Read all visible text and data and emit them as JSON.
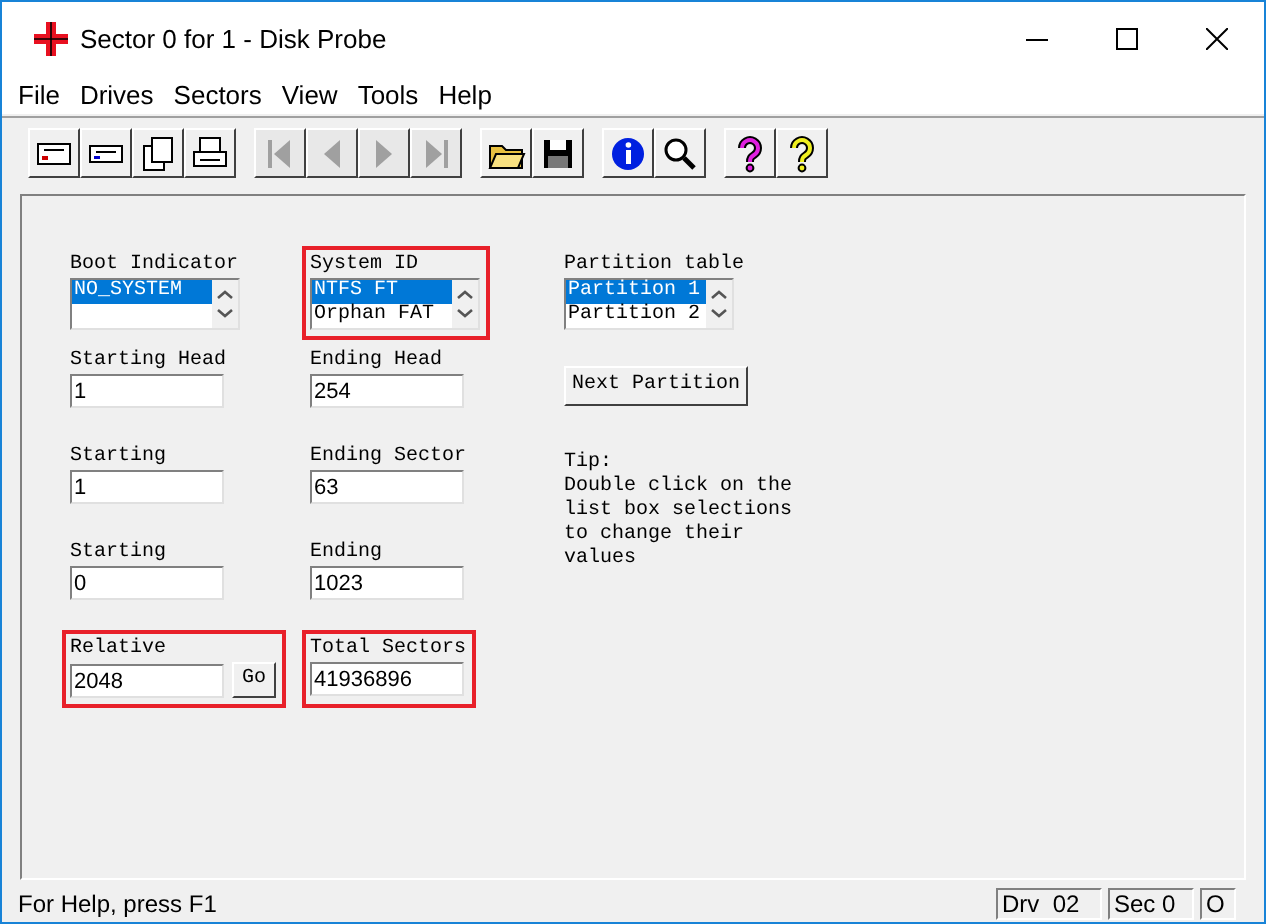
{
  "window": {
    "title": "Sector 0 for 1 - Disk Probe"
  },
  "menu": [
    "File",
    "Drives",
    "Sectors",
    "View",
    "Tools",
    "Help"
  ],
  "toolbar": [
    [
      {
        "disabled": false
      },
      {
        "disabled": false
      },
      {
        "disabled": false
      },
      {
        "disabled": false
      }
    ],
    [
      {
        "disabled": true
      },
      {
        "disabled": true
      },
      {
        "disabled": true
      },
      {
        "disabled": true
      }
    ],
    [
      {
        "disabled": false
      },
      {
        "disabled": false
      }
    ],
    [
      {
        "disabled": false
      },
      {
        "disabled": false
      }
    ],
    [
      {
        "disabled": false
      },
      {
        "disabled": false
      }
    ]
  ],
  "form": {
    "rows": [
      [
        {
          "kind": "listbox",
          "label": "Boot Indicator",
          "highlighted": false,
          "items": [
            {
              "text": "NO_SYSTEM",
              "selected": true
            }
          ]
        },
        {
          "kind": "listbox",
          "label": "System ID",
          "highlighted": true,
          "items": [
            {
              "text": "NTFS FT",
              "selected": true
            },
            {
              "text": "Orphan FAT",
              "selected": false
            }
          ]
        },
        {
          "kind": "listbox",
          "label": "Partition table",
          "highlighted": false,
          "items": [
            {
              "text": "Partition 1",
              "selected": true
            },
            {
              "text": "Partition 2",
              "selected": false
            }
          ]
        }
      ],
      [
        {
          "kind": "field",
          "label": "Starting Head",
          "value": "1",
          "highlighted": false
        },
        {
          "kind": "field",
          "label": "Ending Head",
          "value": "254",
          "highlighted": false
        },
        {
          "kind": "button",
          "label": "Next Partition"
        }
      ],
      [
        {
          "kind": "field",
          "label": "Starting",
          "value": "1",
          "highlighted": false
        },
        {
          "kind": "field",
          "label": "Ending Sector",
          "value": "63",
          "highlighted": false
        },
        {
          "kind": "tip",
          "lines": [
            "Tip:",
            "Double click on the",
            "list box selections",
            "to change their",
            "values"
          ]
        }
      ],
      [
        {
          "kind": "field",
          "label": "Starting",
          "value": "0",
          "highlighted": false
        },
        {
          "kind": "field",
          "label": "Ending",
          "value": "1023",
          "highlighted": false
        }
      ],
      [
        {
          "kind": "field",
          "label": "Relative",
          "value": "2048",
          "highlighted": true,
          "button": "Go"
        },
        {
          "kind": "field",
          "label": "Total Sectors",
          "value": "41936896",
          "highlighted": true
        }
      ]
    ]
  },
  "status_bar": {
    "message": "For Help, press F1",
    "panes": [
      "Drv  02",
      "Sec 0",
      "O"
    ]
  }
}
